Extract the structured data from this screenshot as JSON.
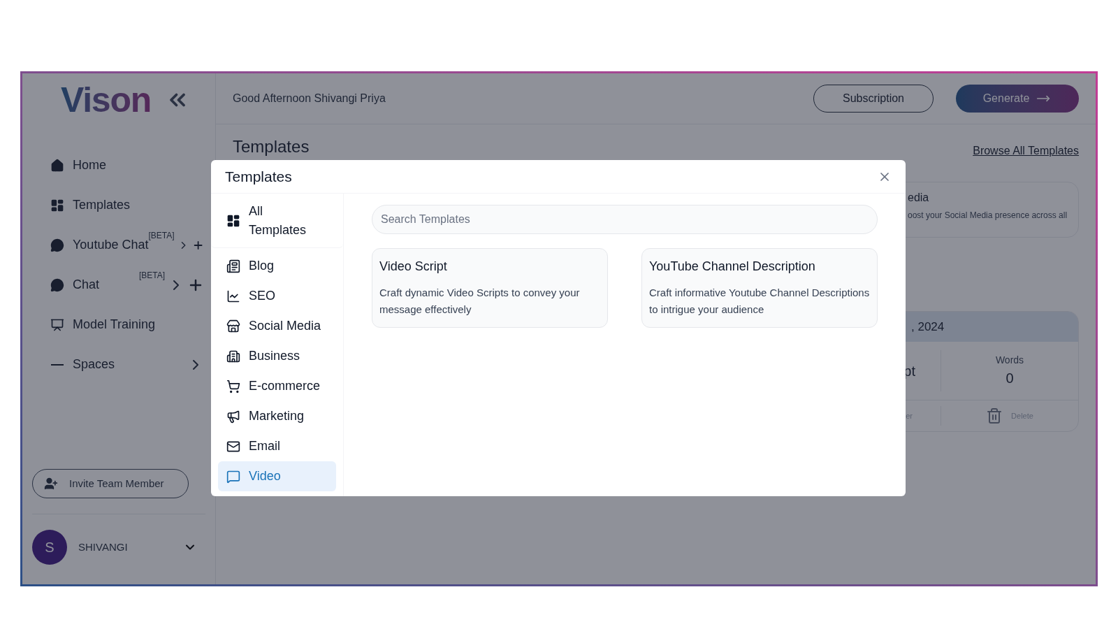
{
  "sidebar": {
    "logo": "Vison",
    "nav": [
      {
        "label": "Home",
        "kind": "link"
      },
      {
        "label": "Templates",
        "kind": "link"
      },
      {
        "label": "Youtube Chat",
        "kind": "chat",
        "badge": "[BETA]"
      },
      {
        "label": "Chat",
        "kind": "chat",
        "badge": "[BETA]"
      },
      {
        "label": "Model Training",
        "kind": "link"
      },
      {
        "label": "Spaces",
        "kind": "group"
      }
    ],
    "invite_button": "Invite Team Member",
    "user": {
      "initial": "S",
      "name": "SHIVANGI"
    }
  },
  "header": {
    "greeting": "Good Afternoon Shivangi Priya",
    "subscription_button": "Subscription",
    "generate_button": "Generate"
  },
  "background": {
    "heading": "Templates",
    "link": "Browse All Templates",
    "card": {
      "title": "edia",
      "description": "oost your Social Media presence across all"
    },
    "document": {
      "date": ", 2024",
      "name": "pt",
      "words_label": "Words",
      "words": "0",
      "action_1": "er",
      "action_2": "Delete"
    }
  },
  "modal": {
    "title": "Templates",
    "categories": [
      {
        "label": "All Templates",
        "selected": false
      },
      {
        "label": "Blog",
        "selected": false
      },
      {
        "label": "SEO",
        "selected": false
      },
      {
        "label": "Social Media",
        "selected": false
      },
      {
        "label": "Business",
        "selected": false
      },
      {
        "label": "E-commerce",
        "selected": false
      },
      {
        "label": "Marketing",
        "selected": false
      },
      {
        "label": "Email",
        "selected": false
      },
      {
        "label": "Video",
        "selected": true
      }
    ],
    "search": {
      "placeholder": "Search Templates"
    },
    "templates": [
      {
        "title": "Video Script",
        "description": "Craft dynamic Video Scripts to convey your message effectively"
      },
      {
        "title": "YouTube Channel Description",
        "description": "Craft informative Youtube Channel Descriptions to intrigue your audience"
      }
    ]
  }
}
